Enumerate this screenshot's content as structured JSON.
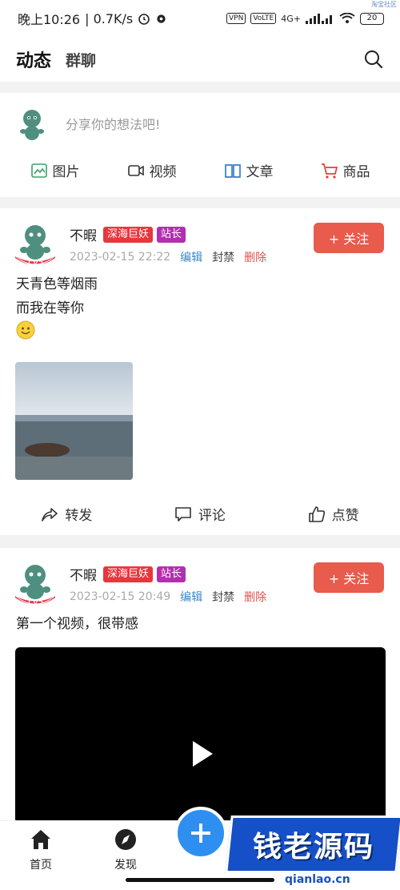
{
  "status_bar": {
    "time": "晚上10:26",
    "speed": "| 0.7K/s",
    "vpn": "VPN",
    "volte": "VoLTE",
    "net": "4G+",
    "battery": "20"
  },
  "watermark_top": "淘宝社区",
  "top_nav": {
    "tab_active": "动态",
    "tab_group": "群聊"
  },
  "composer": {
    "placeholder": "分享你的想法吧!",
    "actions": [
      "图片",
      "视频",
      "文章",
      "商品"
    ]
  },
  "posts": [
    {
      "name": "不暇",
      "badge1": "深海巨妖",
      "badge2": "站长",
      "level": "Lv5",
      "date": "2023-02-15 22:22",
      "edit": "编辑",
      "ban": "封禁",
      "delete": "删除",
      "follow": "+ 关注",
      "text_line1": "天青色等烟雨",
      "text_line2": "而我在等你",
      "actions": [
        "转发",
        "评论",
        "点赞"
      ]
    },
    {
      "name": "不暇",
      "badge1": "深海巨妖",
      "badge2": "站长",
      "level": "Lv5",
      "date": "2023-02-15 20:49",
      "edit": "编辑",
      "ban": "封禁",
      "delete": "删除",
      "follow": "+ 关注",
      "text_line1": "第一个视频，很带感"
    }
  ],
  "bottom_nav": {
    "home": "首页",
    "discover": "发现"
  },
  "watermark": {
    "brand": "钱老源码",
    "url": "qianlao.cn"
  },
  "colors": {
    "accent_red": "#e85b4d",
    "fab_blue": "#2e8ff0",
    "edit_blue": "#3a86c8"
  }
}
